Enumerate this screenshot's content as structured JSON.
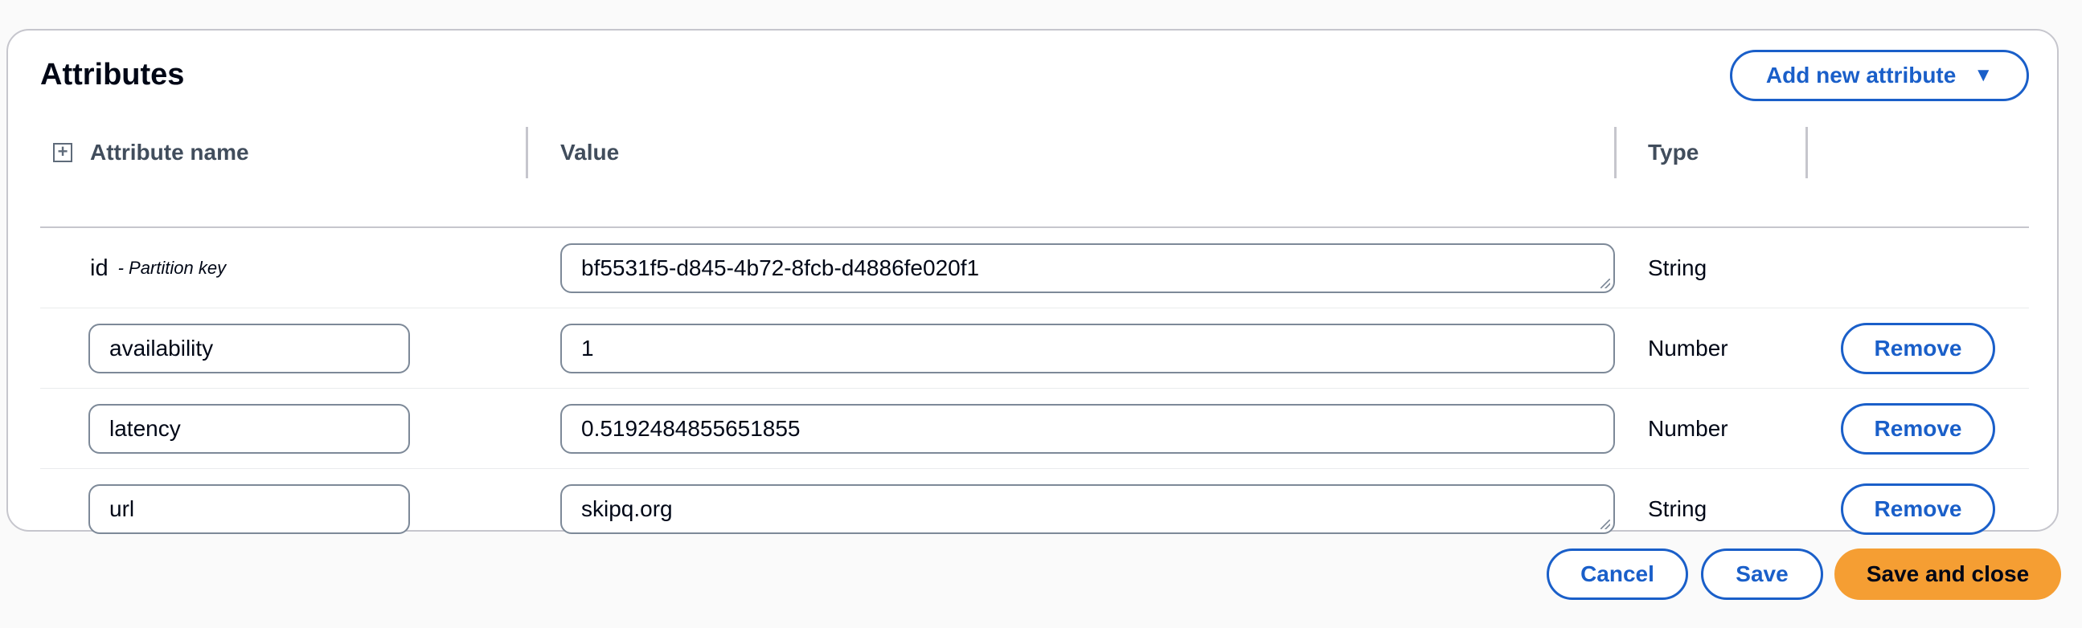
{
  "section": {
    "title": "Attributes",
    "add_button_label": "Add new attribute",
    "add_button_caret": "▼"
  },
  "columns": {
    "name": "Attribute name",
    "value": "Value",
    "type": "Type"
  },
  "rows": [
    {
      "name": "id",
      "name_note": "- Partition key",
      "value": "bf5531f5-d845-4b72-8fcb-d4886fe020f1",
      "type": "String",
      "editable_name": false
    },
    {
      "name": "availability",
      "value": "1",
      "type": "Number",
      "editable_name": true,
      "remove_label": "Remove"
    },
    {
      "name": "latency",
      "value": "0.5192484855651855",
      "type": "Number",
      "editable_name": true,
      "remove_label": "Remove"
    },
    {
      "name": "url",
      "value": "skipq.org",
      "type": "String",
      "editable_name": true,
      "remove_label": "Remove"
    }
  ],
  "footer": {
    "cancel_label": "Cancel",
    "save_label": "Save",
    "save_close_label": "Save and close"
  },
  "colors": {
    "accent": "#1a5fc9",
    "primary_button": "#f59e33",
    "border": "#c6c6cd"
  }
}
